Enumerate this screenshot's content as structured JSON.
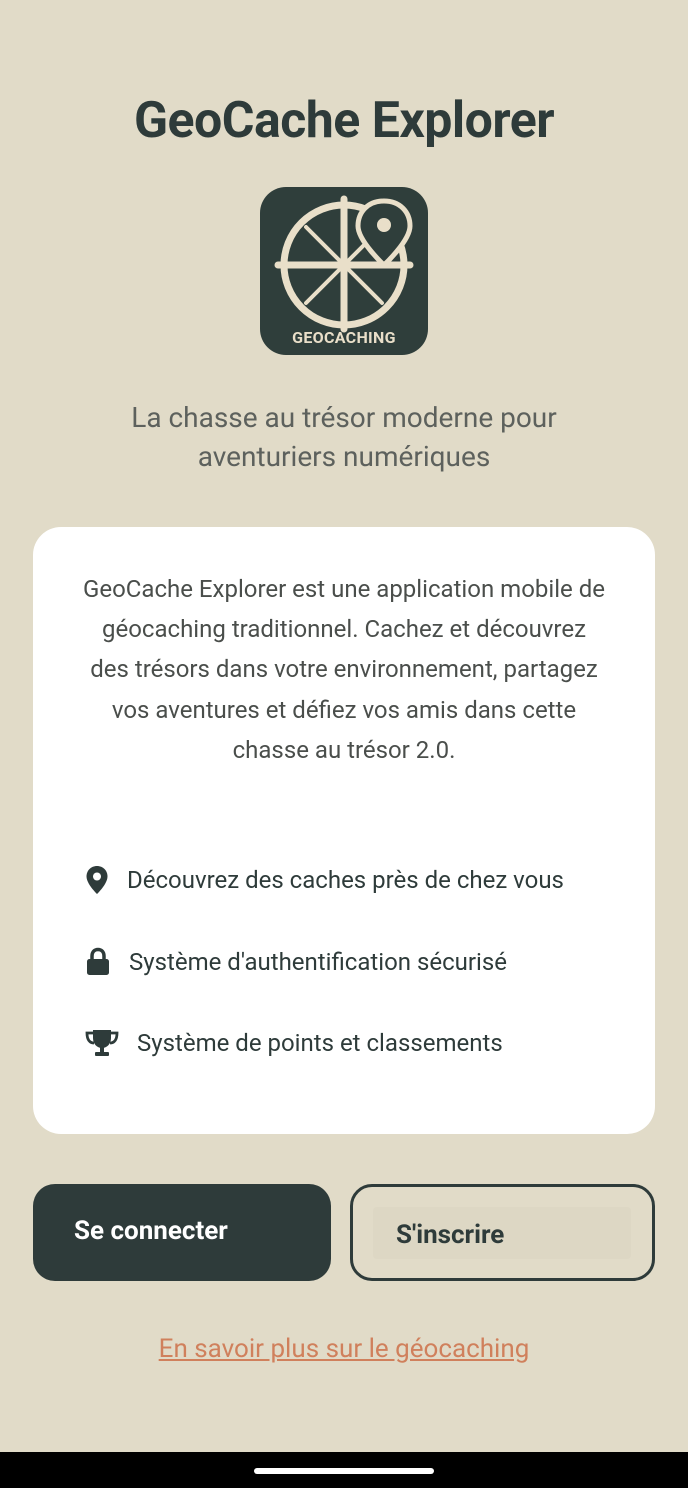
{
  "app": {
    "title": "GeoCache Explorer",
    "logo_text": "GEOCACHING",
    "tagline": "La chasse au trésor moderne pour aventuriers numériques"
  },
  "card": {
    "description": "GeoCache Explorer est une application mobile de géocaching traditionnel. Cachez et découvrez des trésors dans votre environnement, partagez vos aventures et défiez vos amis dans cette chasse au trésor 2.0.",
    "features": [
      {
        "icon": "map-pin-icon",
        "label": "Découvrez des caches près de chez vous"
      },
      {
        "icon": "lock-icon",
        "label": "Système d'authentification sécurisé"
      },
      {
        "icon": "trophy-icon",
        "label": "Système de points et classements"
      }
    ]
  },
  "actions": {
    "login_label": "Se connecter",
    "signup_label": "S'inscrire",
    "learn_more_label": "En savoir plus sur le géocaching"
  },
  "colors": {
    "background": "#e1dbc8",
    "primary": "#2e3b3a",
    "card": "#ffffff",
    "link": "#d0805c"
  }
}
